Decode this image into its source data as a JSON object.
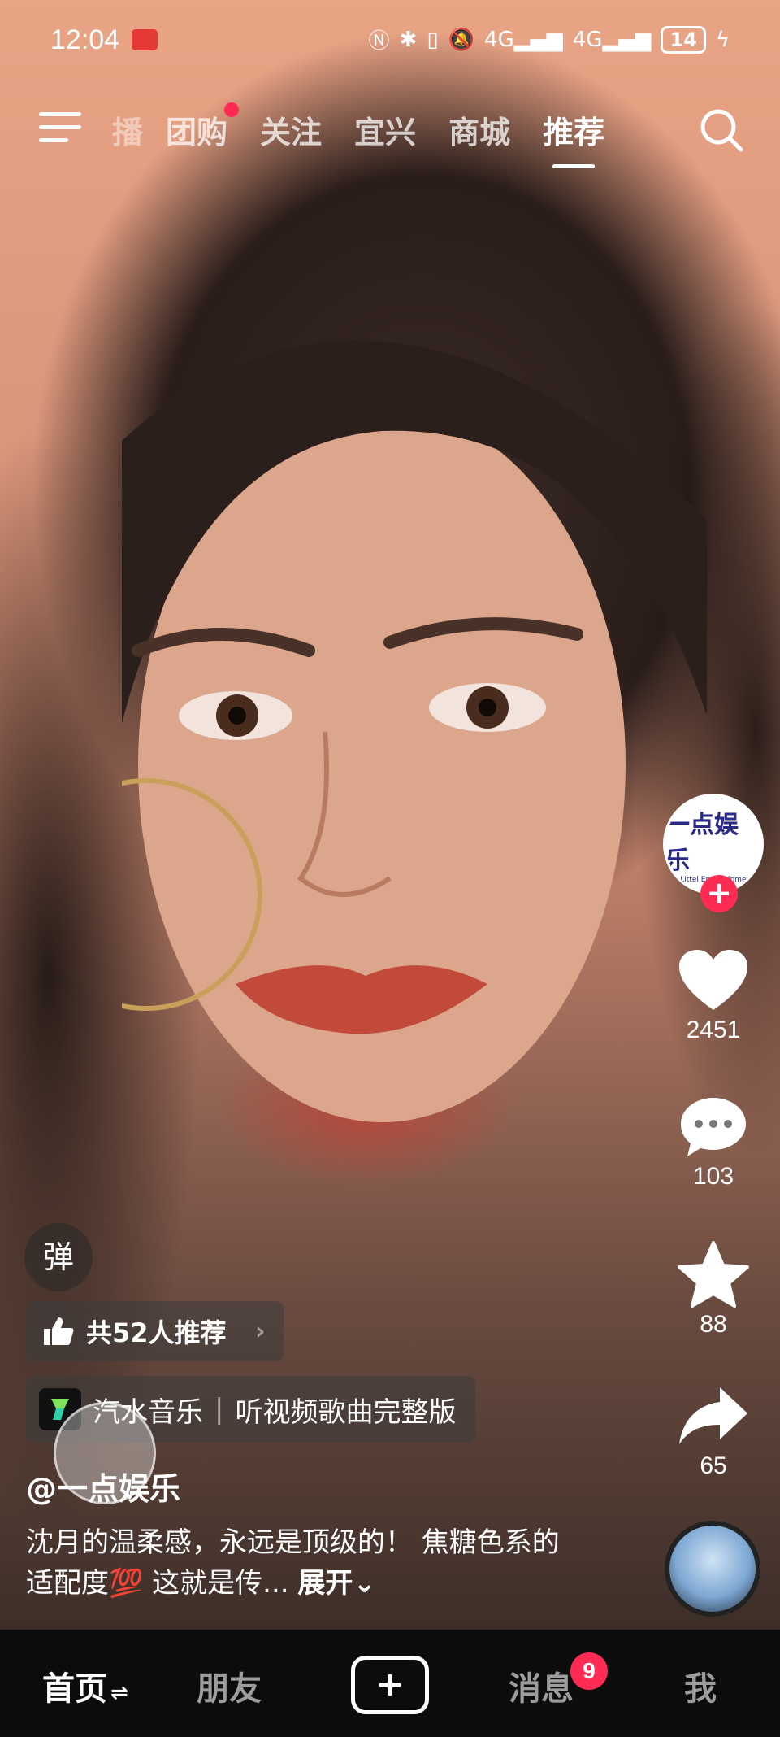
{
  "status_bar": {
    "time": "12:04",
    "network": "4G",
    "battery": "14"
  },
  "top_nav": {
    "tabs": [
      {
        "label": "播"
      },
      {
        "label": "团购"
      },
      {
        "label": "关注"
      },
      {
        "label": "宜兴"
      },
      {
        "label": "商城"
      },
      {
        "label": "推荐"
      }
    ],
    "active_tab": "推荐",
    "tab_dot_color": "#fe2c55"
  },
  "rail": {
    "avatar_logo_text": "一点娱乐",
    "avatar_logo_sub": "A Littel Entertainment",
    "likes": "2451",
    "comments": "103",
    "favorites": "88",
    "shares": "65"
  },
  "danmu": "弹",
  "recommend": {
    "text": "共52人推荐"
  },
  "music": {
    "app": "汽水音乐",
    "cta": "听视频歌曲完整版"
  },
  "post": {
    "handle": "@一点娱乐",
    "caption": "沈月的温柔感，永远是顶级的！ 焦糖色系的适配度💯 这就是传...",
    "expand": "展开"
  },
  "bottom_nav": {
    "home": "首页",
    "friends": "朋友",
    "messages": "消息",
    "messages_badge": "9",
    "me": "我"
  },
  "colors": {
    "accent": "#fe2c55"
  }
}
